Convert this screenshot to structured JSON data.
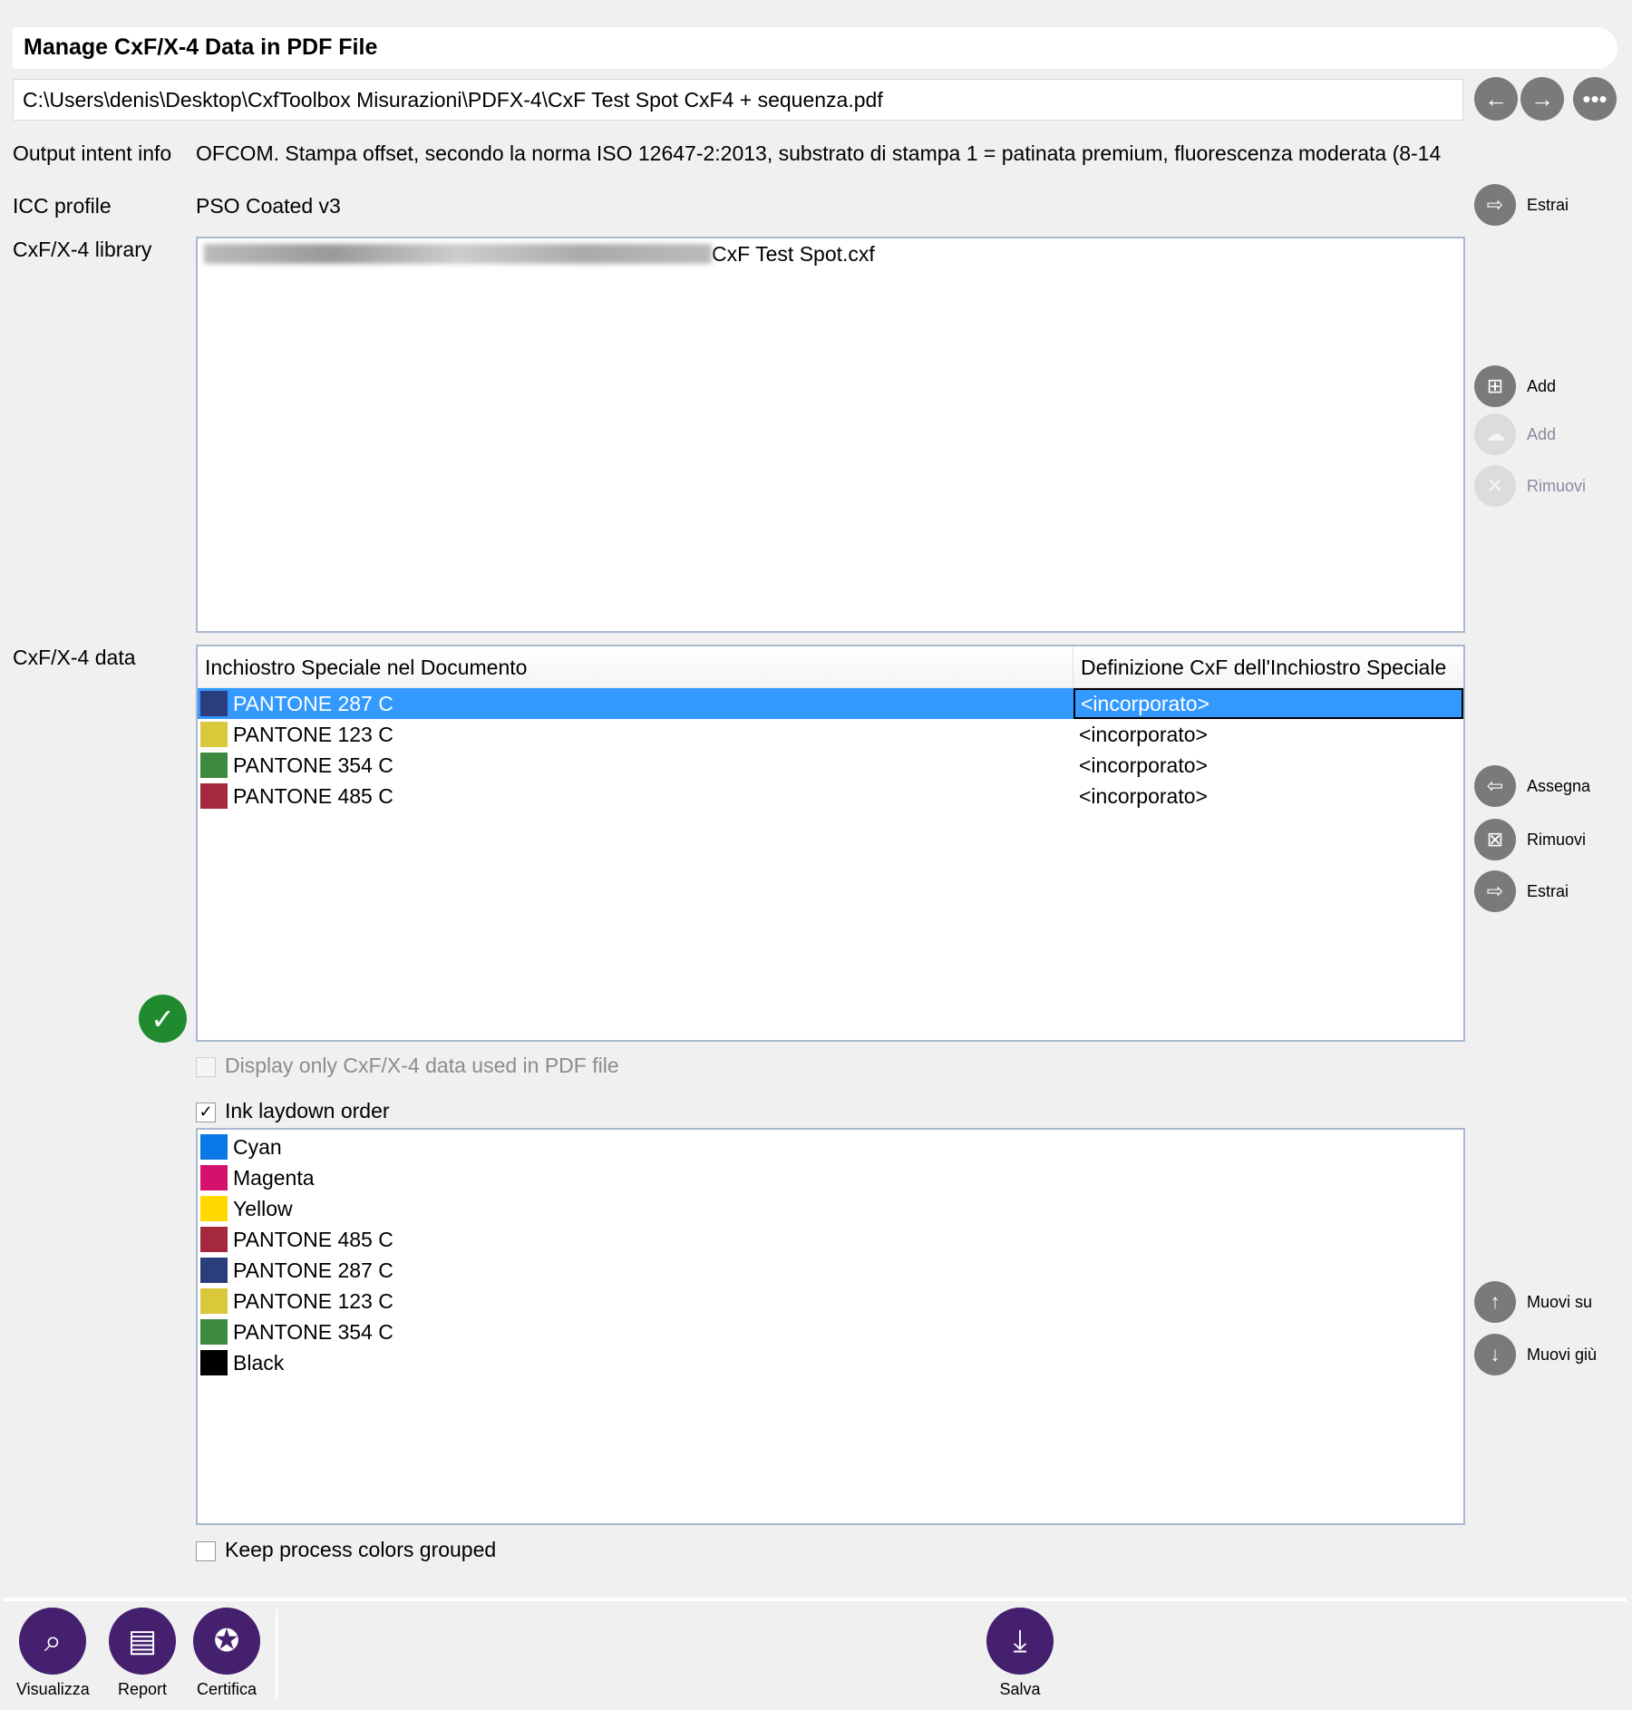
{
  "title": "Manage CxF/X-4 Data in PDF File",
  "path": "C:\\Users\\denis\\Desktop\\CxfToolbox Misurazioni\\PDFX-4\\CxF Test Spot CxF4 + sequenza.pdf",
  "output_intent": {
    "label": "Output intent info",
    "value": "OFCOM. Stampa offset, secondo la norma ISO 12647-2:2013, substrato di stampa 1 = patinata premium, fluorescenza moderata (8-14"
  },
  "icc": {
    "label": "ICC profile",
    "value": "PSO Coated v3",
    "extract": "Estrai"
  },
  "library": {
    "label": "CxF/X-4 library",
    "file": "CxF Test Spot.cxf",
    "add": "Add",
    "add_cloud": "Add",
    "remove": "Rimuovi"
  },
  "data": {
    "label": "CxF/X-4 data",
    "col1": "Inchiostro Speciale nel Documento",
    "col2": "Definizione CxF dell'Inchiostro Speciale",
    "rows": [
      {
        "name": "PANTONE 287 C",
        "def": "<incorporato>",
        "color": "#2b3d7c"
      },
      {
        "name": "PANTONE 123 C",
        "def": "<incorporato>",
        "color": "#d8c83a"
      },
      {
        "name": "PANTONE 354 C",
        "def": "<incorporato>",
        "color": "#3b8a3f"
      },
      {
        "name": "PANTONE 485 C",
        "def": "<incorporato>",
        "color": "#a5283c"
      }
    ],
    "assign": "Assegna",
    "remove": "Rimuovi",
    "extract": "Estrai"
  },
  "display_only": "Display only CxF/X-4 data used in PDF file",
  "ink_order": {
    "label": "Ink laydown order",
    "checked": true,
    "items": [
      {
        "name": "Cyan",
        "color": "#0a78e6"
      },
      {
        "name": "Magenta",
        "color": "#d5106d"
      },
      {
        "name": "Yellow",
        "color": "#ffd800"
      },
      {
        "name": "PANTONE 485 C",
        "color": "#a5283c"
      },
      {
        "name": "PANTONE 287 C",
        "color": "#2b3d7c"
      },
      {
        "name": "PANTONE 123 C",
        "color": "#d8c83a"
      },
      {
        "name": "PANTONE 354 C",
        "color": "#3b8a3f"
      },
      {
        "name": "Black",
        "color": "#000000"
      }
    ],
    "up": "Muovi su",
    "down": "Muovi giù"
  },
  "keep_grouped": "Keep process colors grouped",
  "toolbar": {
    "view": "Visualizza",
    "report": "Report",
    "certify": "Certifica",
    "save": "Salva"
  }
}
